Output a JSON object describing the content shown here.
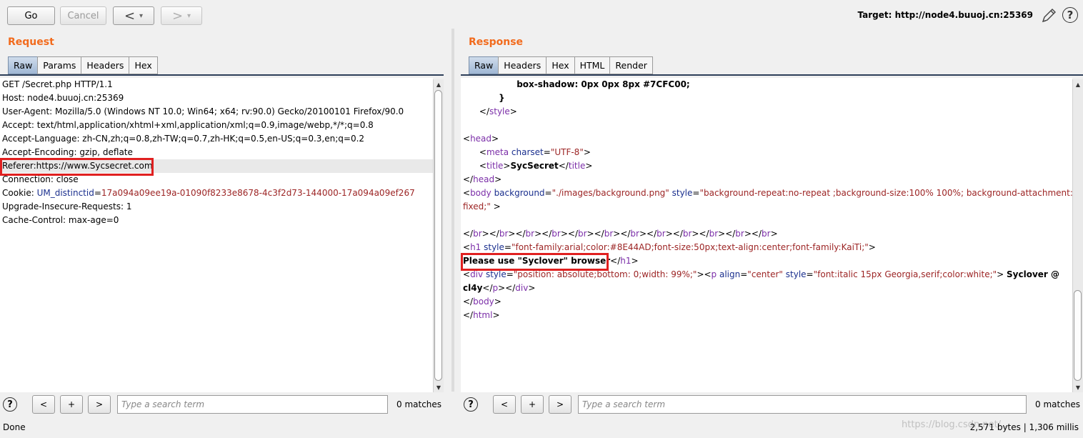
{
  "toolbar": {
    "go_label": "Go",
    "cancel_label": "Cancel",
    "back_symbol": "<",
    "forward_symbol": ">",
    "dropdown_symbol": "▾",
    "target_text": "Target: http://node4.buuoj.cn:25369",
    "help_symbol": "?"
  },
  "request": {
    "title": "Request",
    "tabs": [
      "Raw",
      "Params",
      "Headers",
      "Hex"
    ],
    "active_tab": "Raw",
    "lines": [
      [
        {
          "t": "GET /Secret.php HTTP/1.1",
          "c": "plain"
        }
      ],
      [
        {
          "t": "Host: node4.buuoj.cn:25369",
          "c": "plain"
        }
      ],
      [
        {
          "t": "User-Agent: Mozilla/5.0 (Windows NT 10.0; Win64; x64; rv:90.0) Gecko/20100101 Firefox/90.0",
          "c": "plain"
        }
      ],
      [
        {
          "t": "Accept: text/html,application/xhtml+xml,application/xml;q=0.9,image/webp,*/*;q=0.8",
          "c": "plain"
        }
      ],
      [
        {
          "t": "Accept-Language: zh-CN,zh;q=0.8,zh-TW;q=0.7,zh-HK;q=0.5,en-US;q=0.3,en;q=0.2",
          "c": "plain"
        }
      ],
      [
        {
          "t": "Accept-Encoding: gzip, deflate",
          "c": "plain"
        }
      ],
      [
        {
          "t": "Referer:https://www.Sycsecret.com",
          "c": "plain"
        }
      ],
      [
        {
          "t": "Connection: close",
          "c": "plain"
        }
      ],
      [
        {
          "t": "Cookie: ",
          "c": "plain"
        },
        {
          "t": "UM_distinctid",
          "c": "attr"
        },
        {
          "t": "=",
          "c": "plain"
        },
        {
          "t": "17a094a09ee19a-01090f8233e8678-4c3f2d73-144000-17a094a09ef267",
          "c": "val"
        }
      ],
      [
        {
          "t": "Upgrade-Insecure-Requests: 1",
          "c": "plain"
        }
      ],
      [
        {
          "t": "Cache-Control: max-age=0",
          "c": "plain"
        }
      ]
    ],
    "search_placeholder": "Type a search term",
    "matches": "0 matches"
  },
  "response": {
    "title": "Response",
    "tabs": [
      "Raw",
      "Headers",
      "Hex",
      "HTML",
      "Render"
    ],
    "active_tab": "Raw",
    "lines": [
      [
        {
          "t": "                  box-shadow: 0px 0px 8px #7CFC00;",
          "c": "bold"
        }
      ],
      [
        {
          "t": "            }",
          "c": "bold"
        }
      ],
      [
        {
          "t": "      </",
          "c": "plain"
        },
        {
          "t": "style",
          "c": "tag"
        },
        {
          "t": ">",
          "c": "plain"
        }
      ],
      [
        {
          "t": "",
          "c": "plain"
        }
      ],
      [
        {
          "t": "<",
          "c": "plain"
        },
        {
          "t": "head",
          "c": "tag"
        },
        {
          "t": ">",
          "c": "plain"
        }
      ],
      [
        {
          "t": "      <",
          "c": "plain"
        },
        {
          "t": "meta",
          "c": "tag"
        },
        {
          "t": " charset",
          "c": "attr"
        },
        {
          "t": "=",
          "c": "plain"
        },
        {
          "t": "\"UTF-8\"",
          "c": "val"
        },
        {
          "t": ">",
          "c": "plain"
        }
      ],
      [
        {
          "t": "      <",
          "c": "plain"
        },
        {
          "t": "title",
          "c": "tag"
        },
        {
          "t": ">",
          "c": "plain"
        },
        {
          "t": "SycSecret",
          "c": "bold"
        },
        {
          "t": "</",
          "c": "plain"
        },
        {
          "t": "title",
          "c": "tag"
        },
        {
          "t": ">",
          "c": "plain"
        }
      ],
      [
        {
          "t": "</",
          "c": "plain"
        },
        {
          "t": "head",
          "c": "tag"
        },
        {
          "t": ">",
          "c": "plain"
        }
      ],
      [
        {
          "t": "<",
          "c": "plain"
        },
        {
          "t": "body",
          "c": "tag"
        },
        {
          "t": " background",
          "c": "attr"
        },
        {
          "t": "=",
          "c": "plain"
        },
        {
          "t": "\"./images/background.png\"",
          "c": "val"
        },
        {
          "t": " style",
          "c": "attr"
        },
        {
          "t": "=",
          "c": "plain"
        },
        {
          "t": "\"background-repeat:no-repeat ;background-size:100% 100%; background-attachment:",
          "c": "val"
        }
      ],
      [
        {
          "t": "fixed;\"",
          "c": "val"
        },
        {
          "t": " >",
          "c": "plain"
        }
      ],
      [
        {
          "t": "",
          "c": "plain"
        }
      ],
      [
        {
          "t": "</",
          "c": "plain"
        },
        {
          "t": "br",
          "c": "tag"
        },
        {
          "t": "></",
          "c": "plain"
        },
        {
          "t": "br",
          "c": "tag"
        },
        {
          "t": "></",
          "c": "plain"
        },
        {
          "t": "br",
          "c": "tag"
        },
        {
          "t": "></",
          "c": "plain"
        },
        {
          "t": "br",
          "c": "tag"
        },
        {
          "t": "></",
          "c": "plain"
        },
        {
          "t": "br",
          "c": "tag"
        },
        {
          "t": "></",
          "c": "plain"
        },
        {
          "t": "br",
          "c": "tag"
        },
        {
          "t": "></",
          "c": "plain"
        },
        {
          "t": "br",
          "c": "tag"
        },
        {
          "t": "></",
          "c": "plain"
        },
        {
          "t": "br",
          "c": "tag"
        },
        {
          "t": "></",
          "c": "plain"
        },
        {
          "t": "br",
          "c": "tag"
        },
        {
          "t": "></",
          "c": "plain"
        },
        {
          "t": "br",
          "c": "tag"
        },
        {
          "t": "></",
          "c": "plain"
        },
        {
          "t": "br",
          "c": "tag"
        },
        {
          "t": "></",
          "c": "plain"
        },
        {
          "t": "br",
          "c": "tag"
        },
        {
          "t": ">",
          "c": "plain"
        }
      ],
      [
        {
          "t": "<",
          "c": "plain"
        },
        {
          "t": "h1",
          "c": "tag"
        },
        {
          "t": " style",
          "c": "attr"
        },
        {
          "t": "=",
          "c": "plain"
        },
        {
          "t": "\"font-family:arial;color:#8E44AD;font-size:50px;text-align:center;font-family:KaiTi;\"",
          "c": "val"
        },
        {
          "t": ">",
          "c": "plain"
        }
      ],
      [
        {
          "t": "Please use \"Syclover\" browser",
          "c": "bold"
        },
        {
          "t": "</",
          "c": "plain"
        },
        {
          "t": "h1",
          "c": "tag"
        },
        {
          "t": ">",
          "c": "plain"
        }
      ],
      [
        {
          "t": "<",
          "c": "plain"
        },
        {
          "t": "div",
          "c": "tag"
        },
        {
          "t": " style",
          "c": "attr"
        },
        {
          "t": "=",
          "c": "plain"
        },
        {
          "t": "\"position: absolute;bottom: 0;width: 99%;\"",
          "c": "val"
        },
        {
          "t": "><",
          "c": "plain"
        },
        {
          "t": "p",
          "c": "tag"
        },
        {
          "t": " align",
          "c": "attr"
        },
        {
          "t": "=",
          "c": "plain"
        },
        {
          "t": "\"center\"",
          "c": "val"
        },
        {
          "t": " style",
          "c": "attr"
        },
        {
          "t": "=",
          "c": "plain"
        },
        {
          "t": "\"font:italic 15px Georgia,serif;color:white;\"",
          "c": "val"
        },
        {
          "t": "> ",
          "c": "plain"
        },
        {
          "t": "Syclover @",
          "c": "bold"
        }
      ],
      [
        {
          "t": "cl4y",
          "c": "bold"
        },
        {
          "t": "</",
          "c": "plain"
        },
        {
          "t": "p",
          "c": "tag"
        },
        {
          "t": "></",
          "c": "plain"
        },
        {
          "t": "div",
          "c": "tag"
        },
        {
          "t": ">",
          "c": "plain"
        }
      ],
      [
        {
          "t": "</",
          "c": "plain"
        },
        {
          "t": "body",
          "c": "tag"
        },
        {
          "t": ">",
          "c": "plain"
        }
      ],
      [
        {
          "t": "</",
          "c": "plain"
        },
        {
          "t": "html",
          "c": "tag"
        },
        {
          "t": ">",
          "c": "plain"
        }
      ]
    ],
    "search_placeholder": "Type a search term",
    "matches": "0 matches"
  },
  "search_buttons": {
    "prev": "<",
    "add": "+",
    "next": ">"
  },
  "status": {
    "left": "Done",
    "right": "2,571 bytes | 1,306 millis",
    "watermark": "https://blog.csdn.net/..."
  },
  "colors": {
    "accent_title": "#f26b1d",
    "highlight_box": "#e02020",
    "tag": "#7b2ea8",
    "attr": "#1a2f8e",
    "value": "#9c2424"
  }
}
